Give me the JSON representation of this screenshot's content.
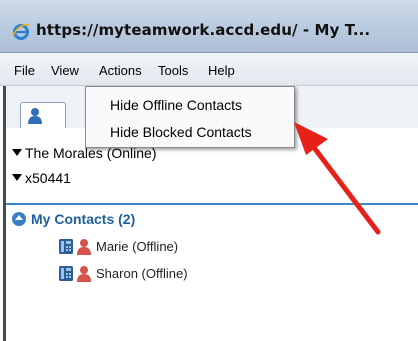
{
  "window": {
    "title": "https://myteamwork.accd.edu/ - My T..."
  },
  "menubar": {
    "items": [
      "File",
      "View",
      "Actions",
      "Tools",
      "Help"
    ]
  },
  "dropdown": {
    "items": [
      "Hide Offline Contacts",
      "Hide Blocked Contacts"
    ]
  },
  "groups": [
    {
      "label": "The Morales (Online)"
    },
    {
      "label": "x50441"
    }
  ],
  "my_contacts": {
    "label": "My Contacts (2)",
    "contacts": [
      {
        "name": "Marie (Offline)"
      },
      {
        "name": "Sharon (Offline)"
      }
    ]
  },
  "colors": {
    "accent": "#3a86c8",
    "arrow": "#e8201a",
    "group_header": "#1f5f9e",
    "offline_person": "#d4534a"
  },
  "icons": {
    "browser": "internet-explorer-icon",
    "tab": "contacts-tab-icon",
    "contact_phone": "phone-icon",
    "contact_person": "person-icon",
    "collapse": "collapse-up-icon"
  }
}
